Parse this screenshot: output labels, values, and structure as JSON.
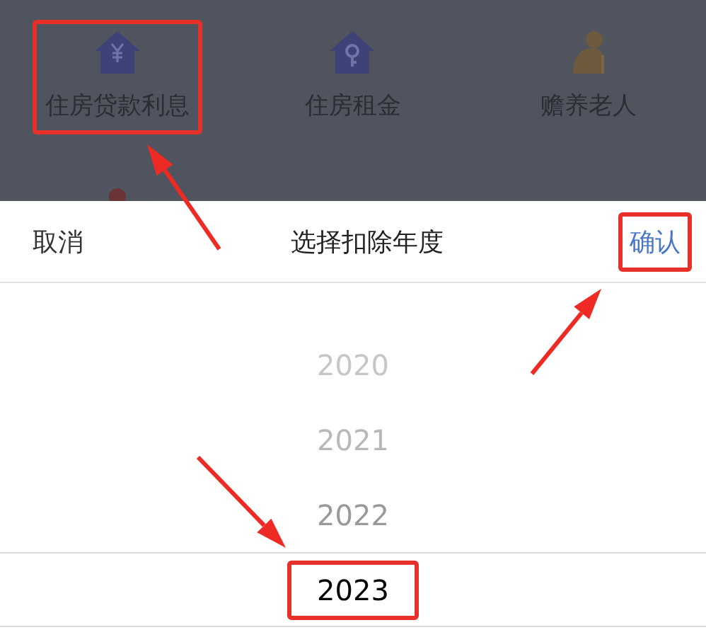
{
  "categories": [
    {
      "kind": "loan",
      "label": "住房贷款利息",
      "highlighted": true
    },
    {
      "kind": "rent",
      "label": "住房租金",
      "highlighted": false
    },
    {
      "kind": "elderly",
      "label": "赡养老人",
      "highlighted": false
    },
    {
      "kind": "partial"
    }
  ],
  "sheet": {
    "cancel": "取消",
    "title": "选择扣除年度",
    "confirm": {
      "label": "确认",
      "highlighted": true
    }
  },
  "years": [
    {
      "label": "2020",
      "selected": false,
      "highlighted": false
    },
    {
      "label": "2021",
      "selected": false,
      "highlighted": false
    },
    {
      "label": "2022",
      "selected": false,
      "highlighted": false
    },
    {
      "label": "2023",
      "selected": true,
      "highlighted": true
    }
  ]
}
